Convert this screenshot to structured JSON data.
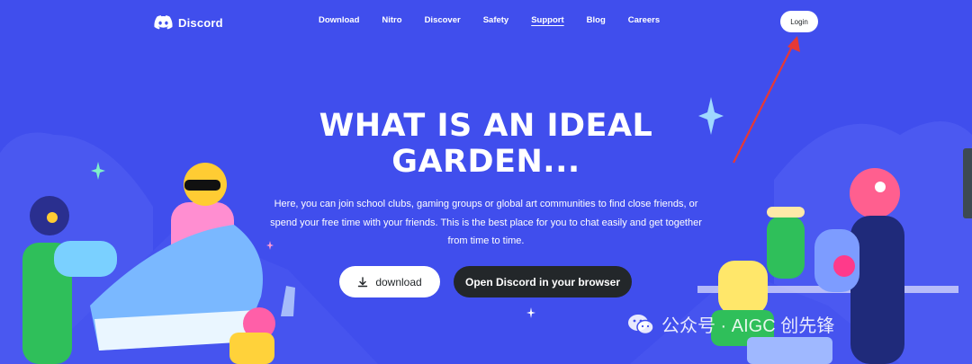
{
  "brand": {
    "name": "Discord"
  },
  "nav": {
    "links": [
      {
        "label": "Download"
      },
      {
        "label": "Nitro"
      },
      {
        "label": "Discover"
      },
      {
        "label": "Safety"
      },
      {
        "label": "Support"
      },
      {
        "label": "Blog"
      },
      {
        "label": "Careers"
      }
    ],
    "active": "Support",
    "login_label": "Login"
  },
  "hero": {
    "title_line1": "WHAT IS AN IDEAL",
    "title_line2": "GARDEN...",
    "subtitle": "Here, you can join school clubs, gaming groups or global art communities to find close friends, or spend your free time with your friends. This is the best place for you to chat easily and get together from time to time.",
    "download_label": "download",
    "open_browser_label": "Open Discord in your browser"
  },
  "watermark": {
    "text": "公众号 · AIGC 创先锋"
  },
  "colors": {
    "background": "#404EED",
    "dark_button": "#23272A",
    "annotation_arrow": "#E53935"
  }
}
